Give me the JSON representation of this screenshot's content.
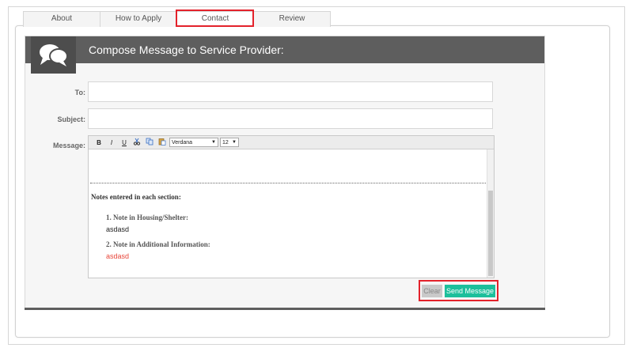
{
  "tabs": [
    {
      "label": "About"
    },
    {
      "label": "How to Apply"
    },
    {
      "label": "Contact"
    },
    {
      "label": "Review"
    }
  ],
  "active_tab": "Contact",
  "panel": {
    "title": "Compose Message to Service Provider:",
    "icon": "speech-bubbles-icon"
  },
  "form": {
    "to_label": "To:",
    "to_value": "",
    "subject_label": "Subject:",
    "subject_value": "",
    "message_label": "Message:"
  },
  "editor": {
    "toolbar": {
      "bold": "B",
      "italic": "I",
      "underline": "U",
      "font": "Verdana",
      "size": "12"
    },
    "notes_heading": "Notes entered in each section:",
    "notes": [
      {
        "title": "1. Note in Housing/Shelter:",
        "value": "asdasd",
        "color": "#222222"
      },
      {
        "title": "2. Note in Additional Information:",
        "value": "asdasd",
        "color": "#e8473b"
      }
    ]
  },
  "buttons": {
    "clear": "Clear",
    "send": "Send Message"
  },
  "colors": {
    "header": "#5e5e5e",
    "send_button": "#1cbf9b",
    "highlight": "#e3222b"
  }
}
